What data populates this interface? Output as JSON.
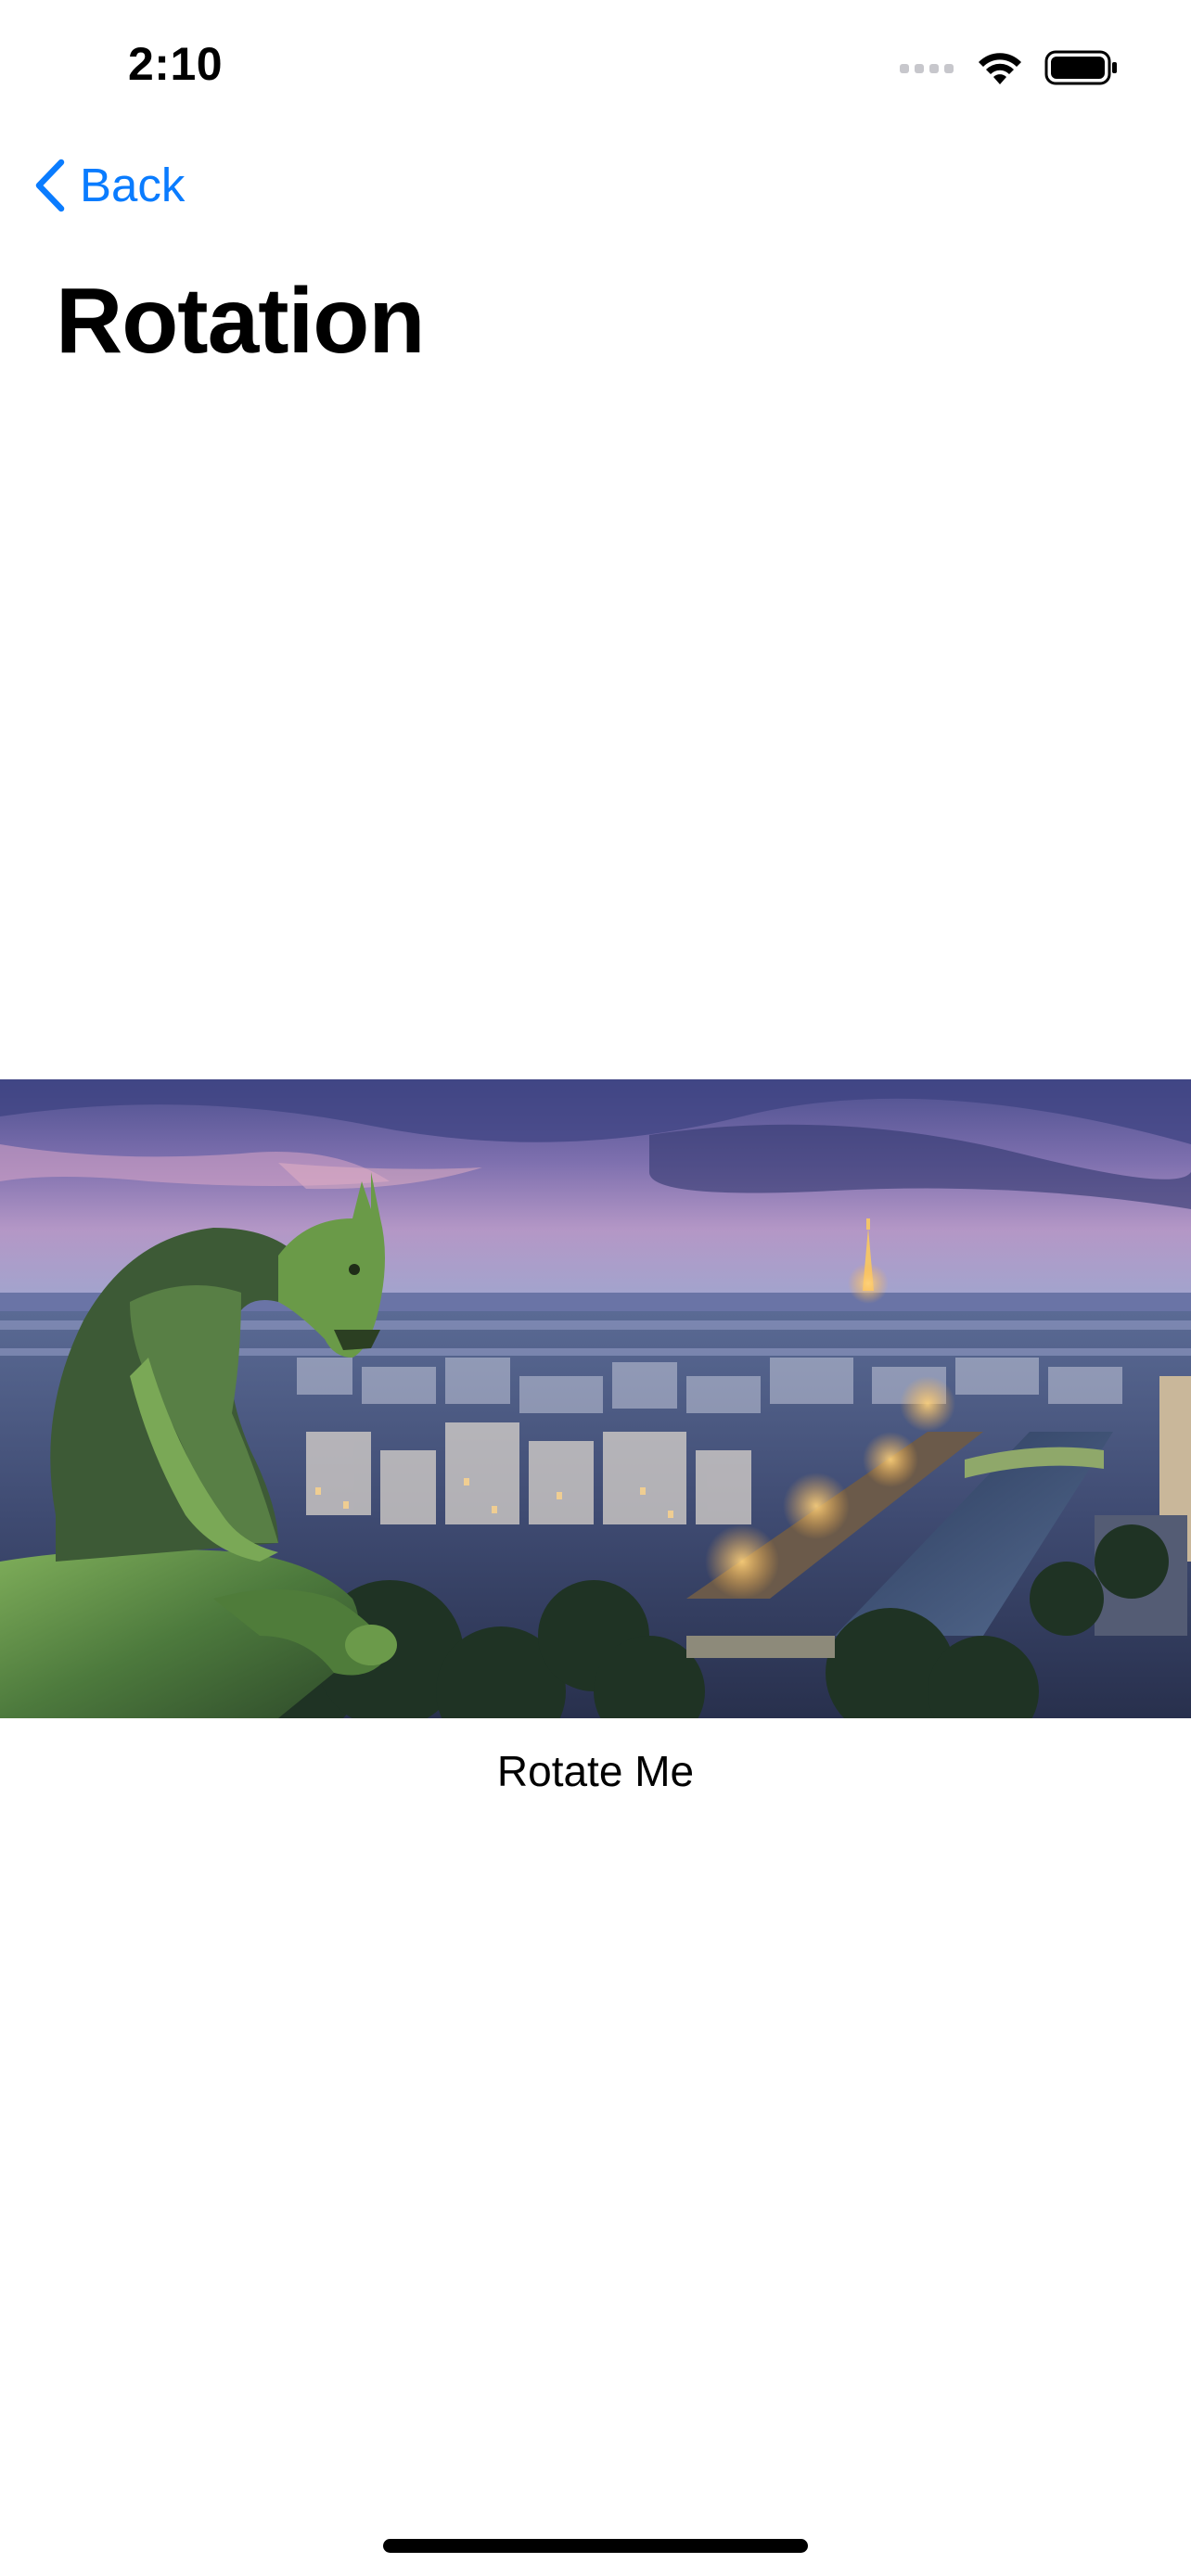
{
  "status_bar": {
    "time": "2:10",
    "icons": [
      "cellular-signal-icon",
      "wifi-icon",
      "battery-icon"
    ]
  },
  "navigation": {
    "back_label": "Back",
    "back_icon": "chevron-left-icon",
    "title": "Rotation"
  },
  "content": {
    "caption": "Rotate Me"
  },
  "colors": {
    "accent": "#0A7CFF",
    "background": "#FFFFFF",
    "text": "#000000"
  }
}
